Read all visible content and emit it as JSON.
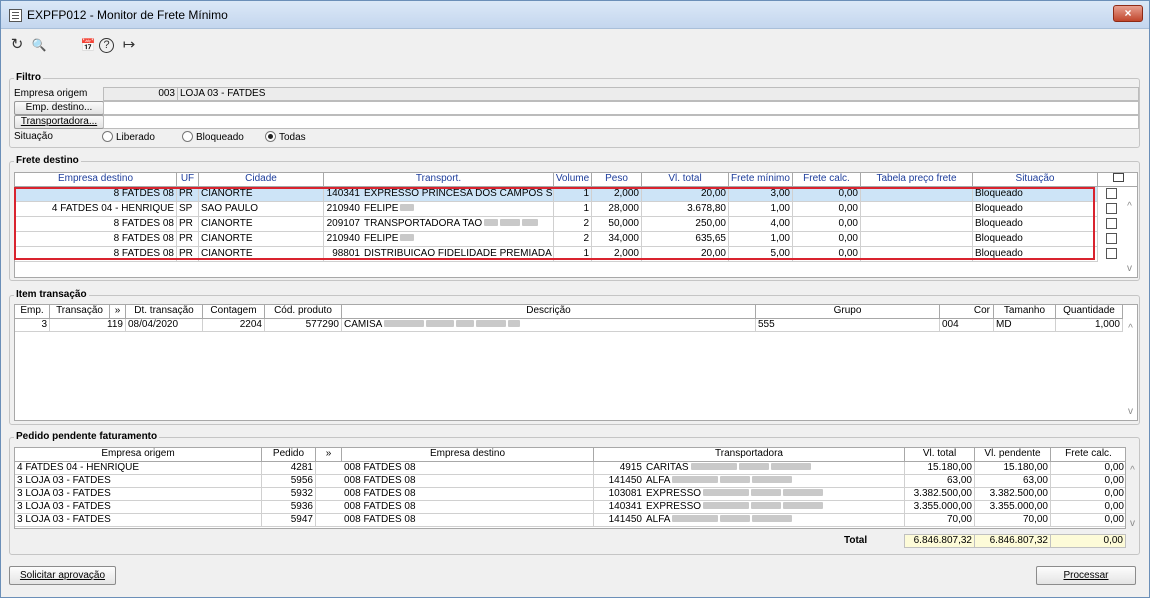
{
  "window": {
    "title": "EXPFP012 - Monitor de Frete Mínimo",
    "close": "×"
  },
  "toolbar": {
    "refresh": "↻",
    "search": "🔍",
    "calendar": "📅",
    "help": "?",
    "exit": "↦"
  },
  "filtro": {
    "title": "Filtro",
    "empresa_origem_label": "Empresa origem",
    "empresa_origem_code": "003",
    "empresa_origem_name": "LOJA 03 - FATDES",
    "emp_destino_btn": "Emp. destino...",
    "emp_destino_value": "",
    "transportadora_btn": "Transportadora...",
    "transportadora_value": "",
    "situacao_label": "Situação",
    "situacao_options": [
      "Liberado",
      "Bloqueado",
      "Todas"
    ],
    "situacao_selected": "Todas"
  },
  "frete": {
    "title": "Frete destino",
    "headers": [
      "Empresa destino",
      "UF",
      "Cidade",
      "Transport.",
      "Volume",
      "Peso",
      "Vl. total",
      "Frete mínimo",
      "Frete calc.",
      "Tabela preço frete",
      "Situação"
    ],
    "rows": [
      {
        "emp": "8 FATDES 08",
        "uf": "PR",
        "cidade": "CIANORTE",
        "tcode": "140341",
        "tname": "EXPRESSO PRINCESA DOS CAMPOS S",
        "volume": "1",
        "peso": "2,000",
        "vltotal": "20,00",
        "fmin": "3,00",
        "fcalc": "0,00",
        "tabela": "",
        "sit": "Bloqueado"
      },
      {
        "emp": "4 FATDES 04 - HENRIQUE",
        "uf": "SP",
        "cidade": "SAO PAULO",
        "tcode": "210940",
        "tname": "FELIPE",
        "volume": "1",
        "peso": "28,000",
        "vltotal": "3.678,80",
        "fmin": "1,00",
        "fcalc": "0,00",
        "tabela": "",
        "sit": "Bloqueado"
      },
      {
        "emp": "8 FATDES 08",
        "uf": "PR",
        "cidade": "CIANORTE",
        "tcode": "209107",
        "tname": "TRANSPORTADORA TAO",
        "volume": "2",
        "peso": "50,000",
        "vltotal": "250,00",
        "fmin": "4,00",
        "fcalc": "0,00",
        "tabela": "",
        "sit": "Bloqueado"
      },
      {
        "emp": "8 FATDES 08",
        "uf": "PR",
        "cidade": "CIANORTE",
        "tcode": "210940",
        "tname": "FELIPE",
        "volume": "2",
        "peso": "34,000",
        "vltotal": "635,65",
        "fmin": "1,00",
        "fcalc": "0,00",
        "tabela": "",
        "sit": "Bloqueado"
      },
      {
        "emp": "8 FATDES 08",
        "uf": "PR",
        "cidade": "CIANORTE",
        "tcode": "98801",
        "tname": "DISTRIBUICAO FIDELIDADE PREMIADA",
        "volume": "1",
        "peso": "2,000",
        "vltotal": "20,00",
        "fmin": "5,00",
        "fcalc": "0,00",
        "tabela": "",
        "sit": "Bloqueado"
      }
    ]
  },
  "item": {
    "title": "Item transação",
    "headers": [
      "Emp.",
      "Transação",
      "»",
      "Dt. transação",
      "Contagem",
      "Cód. produto",
      "Descrição",
      "Grupo",
      "Cor",
      "Tamanho",
      "Quantidade"
    ],
    "rows": [
      {
        "emp": "3",
        "transacao": "119",
        "dt": "08/04/2020",
        "contagem": "2204",
        "cod": "577290",
        "desc": "CAMISA",
        "grupo": "555",
        "cor": "004",
        "tam": "MD",
        "qtd": "1,000"
      }
    ]
  },
  "pedido": {
    "title": "Pedido pendente faturamento",
    "headers": [
      "Empresa origem",
      "Pedido",
      "»",
      "Empresa destino",
      "Transportadora",
      "Vl. total",
      "Vl. pendente",
      "Frete calc."
    ],
    "rows": [
      {
        "origem": "4 FATDES 04 - HENRIQUE",
        "pedido": "4281",
        "destino": "008 FATDES 08",
        "tcode": "4915",
        "tname": "CARITAS",
        "vltotal": "15.180,00",
        "vlpend": "15.180,00",
        "fcalc": "0,00"
      },
      {
        "origem": "3 LOJA 03 - FATDES",
        "pedido": "5956",
        "destino": "008 FATDES 08",
        "tcode": "141450",
        "tname": "ALFA",
        "vltotal": "63,00",
        "vlpend": "63,00",
        "fcalc": "0,00"
      },
      {
        "origem": "3 LOJA 03 - FATDES",
        "pedido": "5932",
        "destino": "008 FATDES 08",
        "tcode": "103081",
        "tname": "EXPRESSO",
        "vltotal": "3.382.500,00",
        "vlpend": "3.382.500,00",
        "fcalc": "0,00"
      },
      {
        "origem": "3 LOJA 03 - FATDES",
        "pedido": "5936",
        "destino": "008 FATDES 08",
        "tcode": "140341",
        "tname": "EXPRESSO",
        "vltotal": "3.355.000,00",
        "vlpend": "3.355.000,00",
        "fcalc": "0,00"
      },
      {
        "origem": "3 LOJA 03 - FATDES",
        "pedido": "5947",
        "destino": "008 FATDES 08",
        "tcode": "141450",
        "tname": "ALFA",
        "vltotal": "70,00",
        "vlpend": "70,00",
        "fcalc": "0,00"
      }
    ],
    "total_label": "Total",
    "total_vltotal": "6.846.807,32",
    "total_vlpend": "6.846.807,32",
    "total_fcalc": "0,00"
  },
  "buttons": {
    "solicitar": "Solicitar aprovação",
    "processar": "Processar"
  }
}
